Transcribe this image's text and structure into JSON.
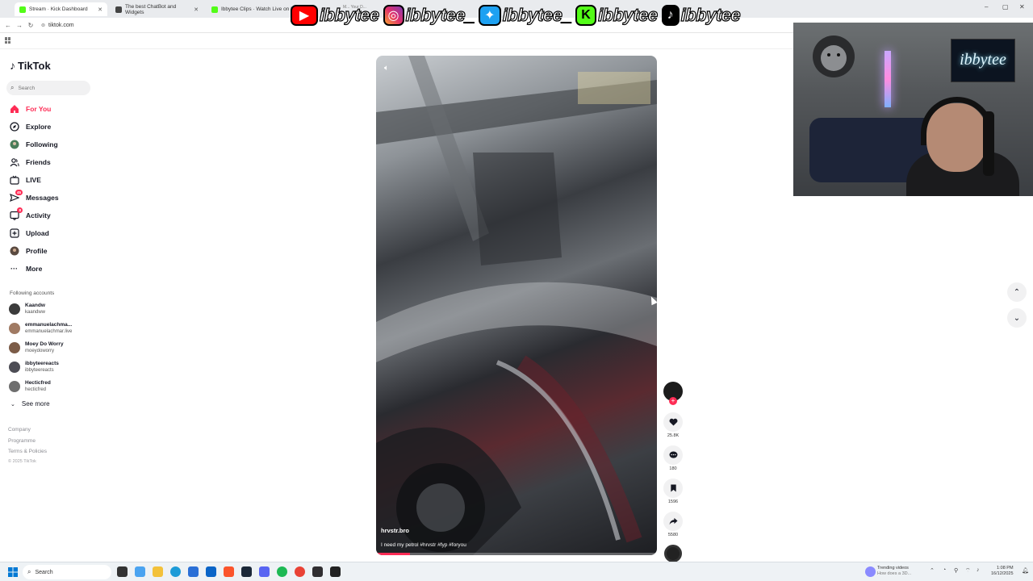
{
  "browser": {
    "tabs": [
      {
        "title": "Stream · Kick Dashboard",
        "color": "#53fc18"
      },
      {
        "title": "The best ChatBot and Widgets",
        "color": "#444444"
      },
      {
        "title": "Ibbytee Clips · Watch Live on K",
        "color": "#53fc18"
      }
    ],
    "tab_overlay_text": "M... Your D...",
    "url": "tiktok.com"
  },
  "social_banner": {
    "youtube": "ibbytee",
    "instagram": "ibbytee_",
    "twitter": "ibbytee_",
    "kick": "ibbytee",
    "tiktok": "ibbytee"
  },
  "sidebar": {
    "logo": "TikTok",
    "search_placeholder": "Search",
    "nav": [
      {
        "label": "For You",
        "icon": "home-icon",
        "active": true
      },
      {
        "label": "Explore",
        "icon": "compass-icon"
      },
      {
        "label": "Following",
        "icon": "following-icon"
      },
      {
        "label": "Friends",
        "icon": "friends-icon"
      },
      {
        "label": "LIVE",
        "icon": "live-icon"
      },
      {
        "label": "Messages",
        "icon": "messages-icon",
        "badge": "45"
      },
      {
        "label": "Activity",
        "icon": "activity-icon",
        "badge": "8"
      },
      {
        "label": "Upload",
        "icon": "upload-icon"
      },
      {
        "label": "Profile",
        "icon": "profile-icon"
      },
      {
        "label": "More",
        "icon": "more-icon"
      }
    ],
    "following_title": "Following accounts",
    "accounts": [
      {
        "name": "Kaandw",
        "handle": "kaandww"
      },
      {
        "name": "emmanuelachma...",
        "handle": "emmanuelachmar.live"
      },
      {
        "name": "Moey Do Worry",
        "handle": "moeydoworry"
      },
      {
        "name": "ibbyteereacts",
        "handle": "ibbyteereacts"
      },
      {
        "name": "Hecticfred",
        "handle": "hecticfred"
      }
    ],
    "see_more": "See more",
    "footer": [
      "Company",
      "Programme",
      "Terms & Policies"
    ],
    "copyright": "© 2025 TikTok"
  },
  "video": {
    "username": "hrvstr.bro",
    "caption": "I need my petrol #hrvstr #fyp #foryou",
    "progress_fraction": 0.12
  },
  "actions": {
    "likes": "25.8K",
    "comments": "180",
    "bookmarks": "1596",
    "shares": "5580"
  },
  "webcam": {
    "neon_sign": "ibbytee"
  },
  "taskbar": {
    "search_placeholder": "Search",
    "trending_title": "Trending videos",
    "trending_sub": "How does a 3D...",
    "time": "1:08 PM",
    "date": "16/12/2025"
  }
}
